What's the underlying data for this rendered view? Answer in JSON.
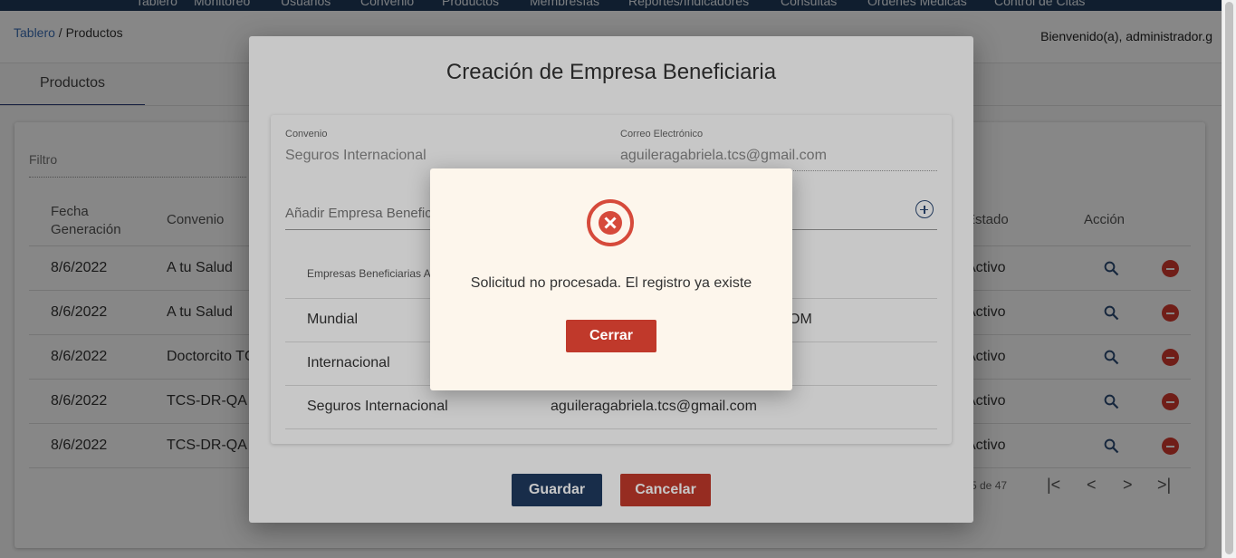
{
  "nav": {
    "items": [
      "Tablero",
      "Monitoreo",
      "Usuarios",
      "Convenio",
      "Productos",
      "Membresías",
      "Reportes/Indicadores",
      "Consultas",
      "Órdenes Médicas",
      "Control de Citas"
    ]
  },
  "header": {
    "breadcrumb_root": "Tablero",
    "breadcrumb_sep": " / ",
    "breadcrumb_current": "Productos",
    "welcome": "Bienvenido(a), administrador.g"
  },
  "tabs": [
    {
      "label": "Productos"
    }
  ],
  "filter": {
    "placeholder": "Filtro"
  },
  "table": {
    "columns": {
      "fecha": "Fecha Generación",
      "convenio": "Convenio",
      "estado": "Estado",
      "accion": "Acción"
    },
    "rows": [
      {
        "fecha": "8/6/2022",
        "convenio": "A tu Salud",
        "estado": "Activo"
      },
      {
        "fecha": "8/6/2022",
        "convenio": "A tu Salud",
        "estado": "Activo"
      },
      {
        "fecha": "8/6/2022",
        "convenio": "Doctorcito TC",
        "estado": "Activo"
      },
      {
        "fecha": "8/6/2022",
        "convenio": "TCS-DR-QA",
        "estado": "Activo"
      },
      {
        "fecha": "8/6/2022",
        "convenio": "TCS-DR-QA",
        "estado": "Activo"
      }
    ],
    "paginator": "5 de 47"
  },
  "modal": {
    "title": "Creación de Empresa Beneficiaria",
    "convenio_label": "Convenio",
    "convenio_value": "Seguros Internacional",
    "correo_label": "Correo Electrónico",
    "correo_value": "aguileragabriela.tcs@gmail.com",
    "add_placeholder": "Añadir Empresa Benefic",
    "list_header": "Empresas Beneficiarias A",
    "entries": [
      {
        "name": "Mundial",
        "email": "OM"
      },
      {
        "name": "Internacional",
        "email": ""
      },
      {
        "name": "Seguros Internacional",
        "email": "aguileragabriela.tcs@gmail.com"
      }
    ],
    "save_label": "Guardar",
    "cancel_label": "Cancelar"
  },
  "alert": {
    "message": "Solicitud no procesada. El registro ya existe",
    "close_label": "Cerrar",
    "icon": "error-x-circle-icon"
  },
  "colors": {
    "primary": "#1f3a5f",
    "danger": "#c0392b",
    "link": "#3b6fb6",
    "alert_bg": "#fdf6ec"
  }
}
